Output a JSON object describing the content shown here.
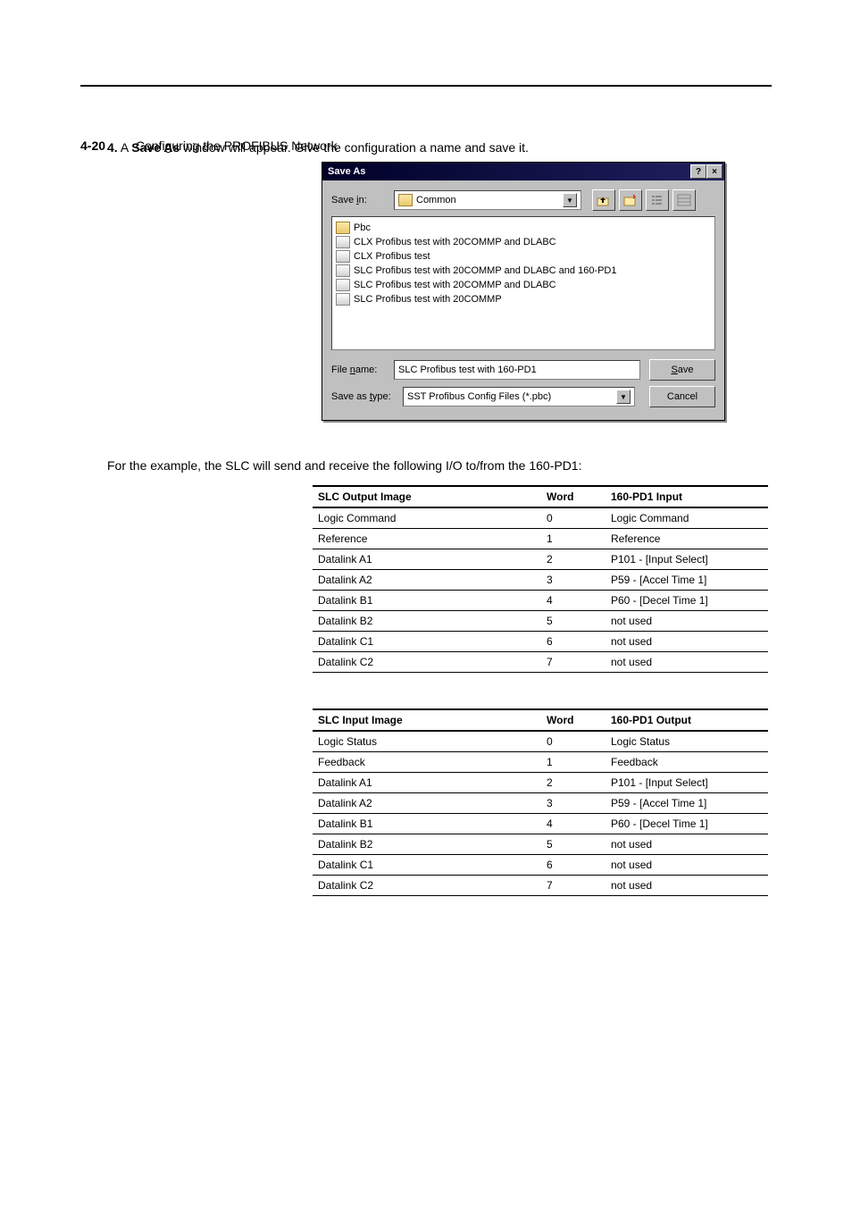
{
  "header": {
    "left_bold": "4-20",
    "left_rest": "Configuring the PROFIBUS Network",
    "right": ""
  },
  "step": {
    "num": "4.",
    "text_a": "A ",
    "bold": "Save As",
    "text_b": " window will appear. Give the configuration a name and save it."
  },
  "dialog": {
    "title": "Save As",
    "save_in_label": "Save in:",
    "save_in_value": "Common",
    "files": [
      {
        "type": "folder",
        "name": "Pbc"
      },
      {
        "type": "file",
        "name": "CLX Profibus test with 20COMMP and DLABC"
      },
      {
        "type": "file",
        "name": "CLX Profibus test"
      },
      {
        "type": "file",
        "name": "SLC Profibus test with 20COMMP and DLABC and 160-PD1"
      },
      {
        "type": "file",
        "name": "SLC Profibus test with 20COMMP and DLABC"
      },
      {
        "type": "file",
        "name": "SLC Profibus test with 20COMMP"
      }
    ],
    "file_name_label": "File name:",
    "file_name_value": "SLC Profibus test with 160-PD1",
    "save_type_label": "Save as type:",
    "save_type_value": "SST Profibus Config Files (*.pbc)",
    "save_btn": "Save",
    "cancel_btn": "Cancel"
  },
  "para1": "For the example, the SLC will send and receive the following I/O to/from the 160-PD1:",
  "table1": {
    "headers": [
      "SLC Output Image",
      "Word",
      "160-PD1 Input"
    ],
    "rows": [
      [
        "Logic Command",
        "0",
        "Logic Command"
      ],
      [
        "Reference",
        "1",
        "Reference"
      ],
      [
        "Datalink A1",
        "2",
        "P101 - [Input Select]"
      ],
      [
        "Datalink A2",
        "3",
        "P59 - [Accel Time 1]"
      ],
      [
        "Datalink B1",
        "4",
        "P60 - [Decel Time 1]"
      ],
      [
        "Datalink B2",
        "5",
        "not used"
      ],
      [
        "Datalink C1",
        "6",
        "not used"
      ],
      [
        "Datalink C2",
        "7",
        "not used"
      ]
    ]
  },
  "table2": {
    "headers": [
      "SLC Input Image",
      "Word",
      "160-PD1 Output"
    ],
    "rows": [
      [
        "Logic Status",
        "0",
        "Logic Status"
      ],
      [
        "Feedback",
        "1",
        "Feedback"
      ],
      [
        "Datalink A1",
        "2",
        "P101 - [Input Select]"
      ],
      [
        "Datalink A2",
        "3",
        "P59 - [Accel Time 1]"
      ],
      [
        "Datalink B1",
        "4",
        "P60 - [Decel Time 1]"
      ],
      [
        "Datalink B2",
        "5",
        "not used"
      ],
      [
        "Datalink C1",
        "6",
        "not used"
      ],
      [
        "Datalink C2",
        "7",
        "not used"
      ]
    ]
  }
}
